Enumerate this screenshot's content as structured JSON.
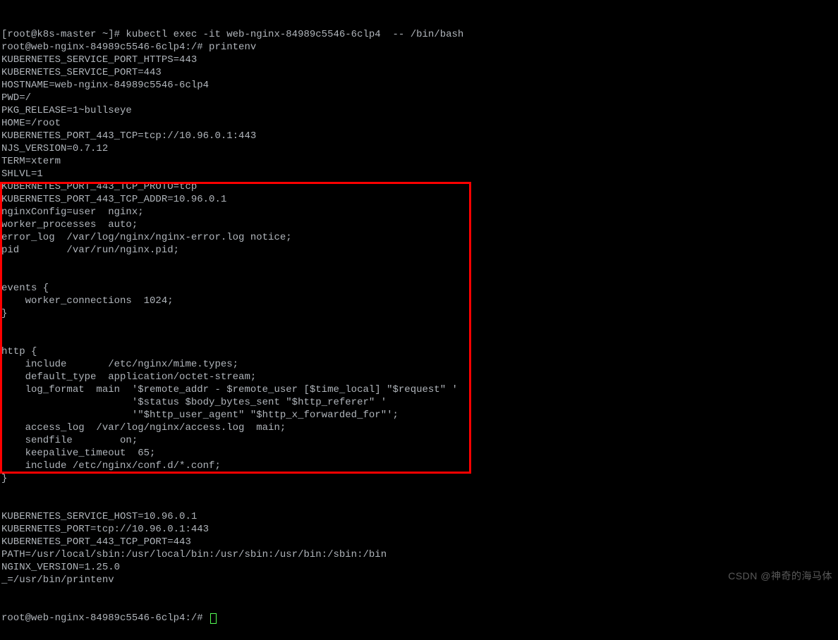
{
  "terminal": {
    "lines": [
      "[root@k8s-master ~]# kubectl exec -it web-nginx-84989c5546-6clp4  -- /bin/bash",
      "root@web-nginx-84989c5546-6clp4:/# printenv",
      "KUBERNETES_SERVICE_PORT_HTTPS=443",
      "KUBERNETES_SERVICE_PORT=443",
      "HOSTNAME=web-nginx-84989c5546-6clp4",
      "PWD=/",
      "PKG_RELEASE=1~bullseye",
      "HOME=/root",
      "KUBERNETES_PORT_443_TCP=tcp://10.96.0.1:443",
      "NJS_VERSION=0.7.12",
      "TERM=xterm",
      "SHLVL=1",
      "KUBERNETES_PORT_443_TCP_PROTO=tcp",
      "KUBERNETES_PORT_443_TCP_ADDR=10.96.0.1",
      "nginxConfig=user  nginx;",
      "worker_processes  auto;",
      "error_log  /var/log/nginx/nginx-error.log notice;",
      "pid        /var/run/nginx.pid;",
      "",
      "",
      "events {",
      "    worker_connections  1024;",
      "}",
      "",
      "",
      "http {",
      "    include       /etc/nginx/mime.types;",
      "    default_type  application/octet-stream;",
      "    log_format  main  '$remote_addr - $remote_user [$time_local] \"$request\" '",
      "                      '$status $body_bytes_sent \"$http_referer\" '",
      "                      '\"$http_user_agent\" \"$http_x_forwarded_for\"';",
      "    access_log  /var/log/nginx/access.log  main;",
      "    sendfile        on;",
      "    keepalive_timeout  65;",
      "    include /etc/nginx/conf.d/*.conf;",
      "}",
      "",
      "",
      "KUBERNETES_SERVICE_HOST=10.96.0.1",
      "KUBERNETES_PORT=tcp://10.96.0.1:443",
      "KUBERNETES_PORT_443_TCP_PORT=443",
      "PATH=/usr/local/sbin:/usr/local/bin:/usr/sbin:/usr/bin:/sbin:/bin",
      "NGINX_VERSION=1.25.0",
      "_=/usr/bin/printenv"
    ],
    "final_prompt": "root@web-nginx-84989c5546-6clp4:/# "
  },
  "watermark": "CSDN @神奇的海马体"
}
